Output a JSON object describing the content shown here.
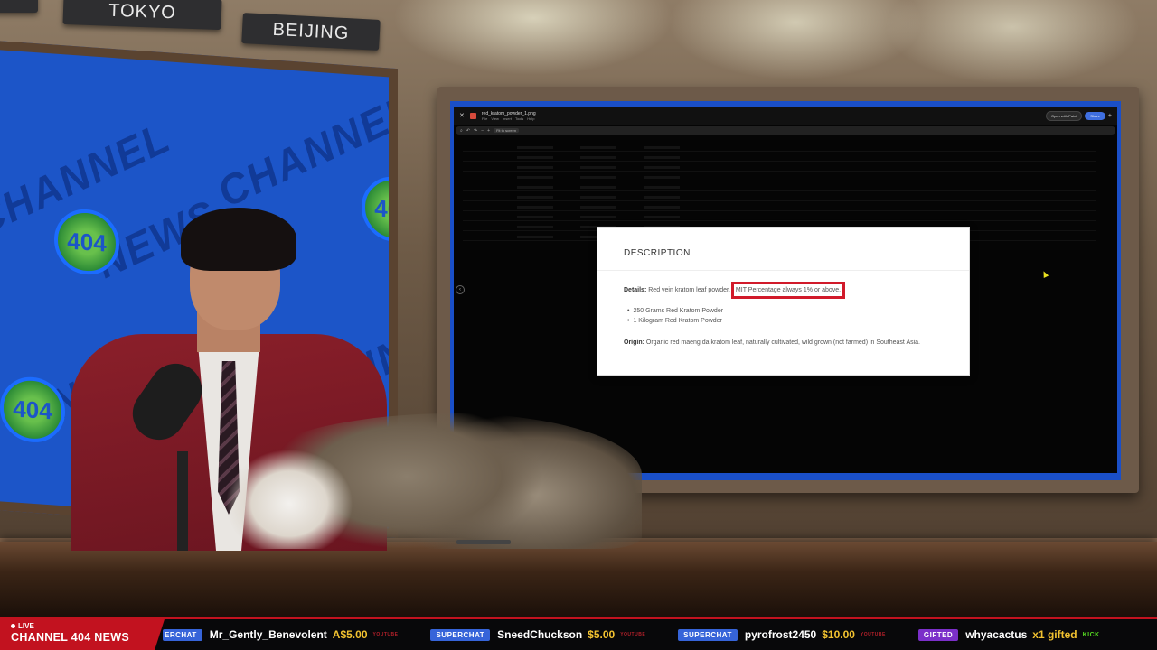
{
  "signs": {
    "left": "",
    "tokyo": "TOKYO",
    "beijing": "BEIJING"
  },
  "background_watermark": {
    "channel": "CHANNEL",
    "news": "NEWS",
    "logo": "404"
  },
  "viewer": {
    "file_name": "red_kratom_powder_1.png",
    "menu": [
      "File",
      "View",
      "Insert",
      "Tools",
      "Help"
    ],
    "open_with": "Open with Paint",
    "share": "Share",
    "zoom_label": "Fit to screen"
  },
  "description_card": {
    "title": "DESCRIPTION",
    "details_label": "Details:",
    "details_text": "Red vein kratom leaf powder.",
    "details_highlight": "MIT Percentage always 1% or above.",
    "bullets": [
      "250 Grams Red Kratom Powder",
      "1 Kilogram Red Kratom Powder"
    ],
    "origin_label": "Origin:",
    "origin_text": "Organic red maeng da kratom leaf, naturally cultivated, wild grown (not farmed) in Southeast Asia."
  },
  "ticker": {
    "live": "LIVE",
    "brand": "CHANNEL 404 NEWS",
    "items": [
      {
        "badge": "ERCHAT",
        "user": "Mr_Gently_Benevolent",
        "amount": "A$5.00",
        "platform": "YOUTUBE"
      },
      {
        "badge": "SUPERCHAT",
        "user": "SneedChuckson",
        "amount": "$5.00",
        "platform": "YOUTUBE"
      },
      {
        "badge": "SUPERCHAT",
        "user": "pyrofrost2450",
        "amount": "$10.00",
        "platform": "YOUTUBE"
      },
      {
        "badge": "GIFTED",
        "user": "whyacactus",
        "amount": "x1 gifted",
        "platform": "KICK"
      }
    ]
  },
  "colors": {
    "ticker_red": "#c2121f",
    "superchat_blue": "#3664d9",
    "gifted_purple": "#7b2fc9",
    "amount_gold": "#f2c230",
    "highlight_red": "#d11a2a"
  }
}
